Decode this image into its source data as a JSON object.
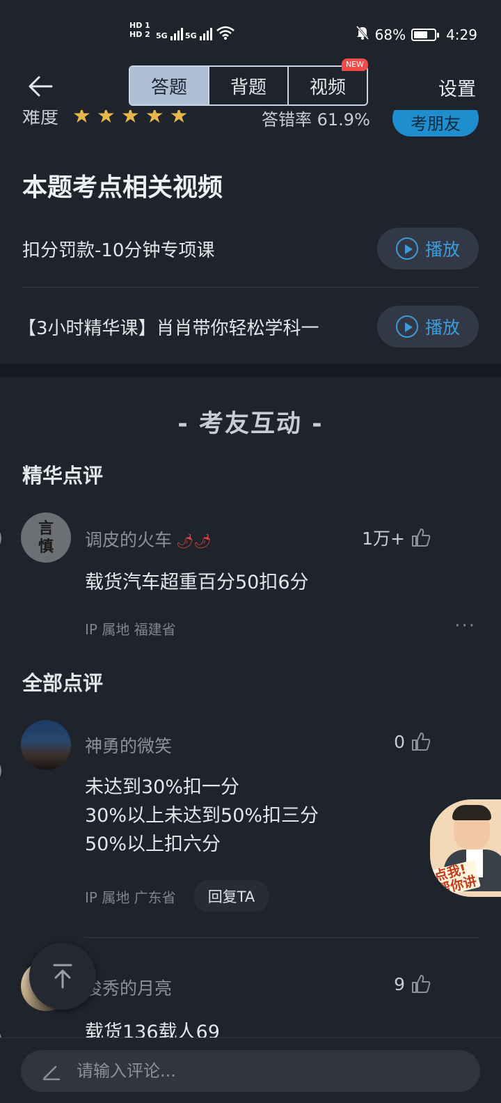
{
  "status": {
    "battery": "68%",
    "time": "4:29",
    "hd1": "HD 1",
    "hd2": "HD 2",
    "net": "5G"
  },
  "nav": {
    "tabs": [
      {
        "label": "答题"
      },
      {
        "label": "背题"
      },
      {
        "label": "视频"
      }
    ],
    "new_badge": "NEW",
    "settings": "设置"
  },
  "difficulty": {
    "label": "难度",
    "stars": 5,
    "error_rate": "答错率 61.9%",
    "ask_friend": "考朋友"
  },
  "videos": {
    "title": "本题考点相关视频",
    "items": [
      {
        "title": "扣分罚款-10分钟专项课",
        "play": "播放"
      },
      {
        "title": "【3小时精华课】肖肖带你轻松学科一",
        "play": "播放"
      }
    ]
  },
  "interaction": {
    "title": "- 考友互动 -",
    "featured_title": "精华点评",
    "all_title": "全部点评"
  },
  "featured": {
    "avatar_chars": [
      "言",
      "慎"
    ],
    "user": "调皮的火车",
    "likes": "1万+",
    "text": "载货汽车超重百分50扣6分",
    "ip": "IP 属地 福建省"
  },
  "comments": [
    {
      "user": "神勇的微笑",
      "likes": "0",
      "lines": [
        "未达到30%扣一分",
        "30%以上未达到50%扣三分",
        "50%以上扣六分"
      ],
      "ip": "IP 属地 广东省",
      "reply": "回复TA"
    },
    {
      "user": "俊秀的月亮",
      "likes": "9",
      "lines": [
        "载货136载人69"
      ]
    }
  ],
  "helper": {
    "line1": "点我!",
    "line2": "帮你讲"
  },
  "input": {
    "placeholder": "请输入评论..."
  },
  "colors": {
    "accent": "#3d9bd8",
    "star": "#e6b74a",
    "badge": "#f04b4b",
    "active_tab": "#aebfd6"
  }
}
